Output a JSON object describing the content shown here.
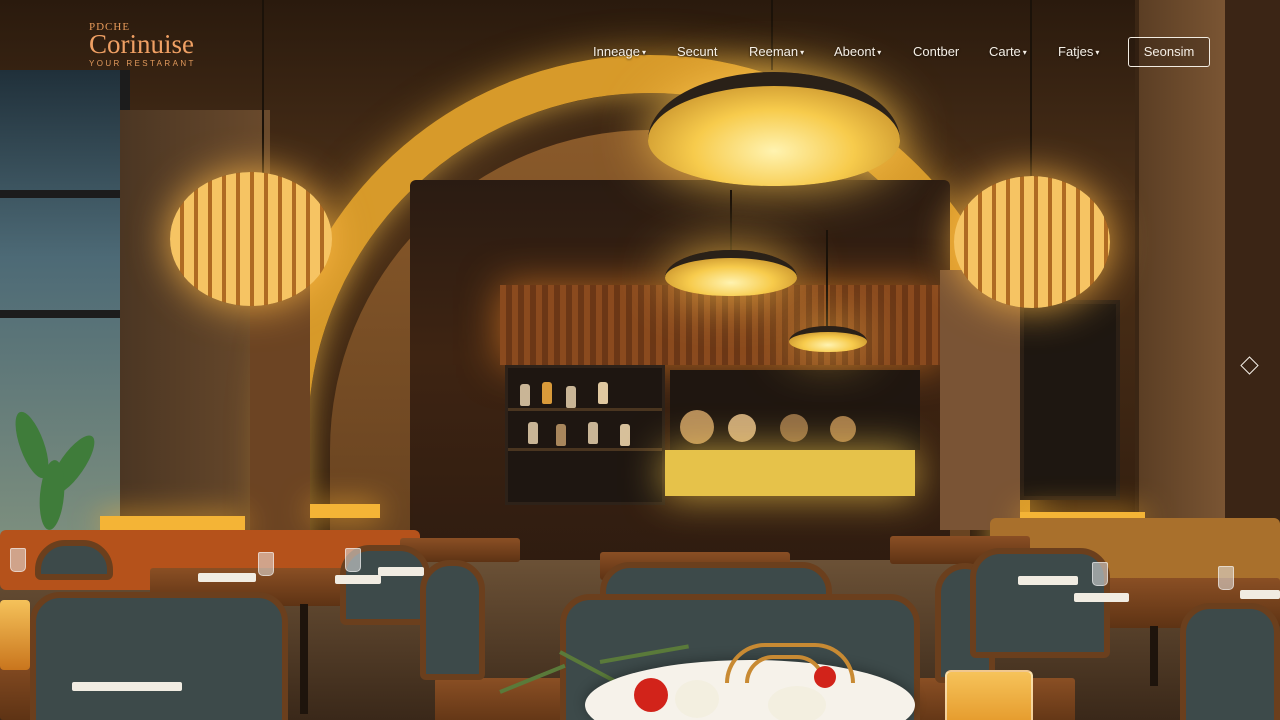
{
  "brand": {
    "small": "PDCHE",
    "name": "Corinuise",
    "tagline": "YOUR RESTARANT"
  },
  "nav": {
    "items": [
      {
        "label": "Inneage",
        "caret": "▾"
      },
      {
        "label": "Secunt",
        "caret": ""
      },
      {
        "label": "Reeman",
        "caret": "▾"
      },
      {
        "label": "Abeont",
        "caret": "▾"
      },
      {
        "label": "Contber",
        "caret": ""
      },
      {
        "label": "Carte",
        "caret": "▾"
      },
      {
        "label": "Fatjes",
        "caret": "▾"
      }
    ],
    "cta_label": "Seonsim"
  },
  "hero": {
    "scene": "restaurant-interior",
    "side_control_icon": "diamond-outline-icon"
  },
  "colors": {
    "brand_accent": "#f0a064",
    "nav_text": "#f5efe6",
    "lamp_glow": "#f7cb4c",
    "wood": "#8a4f24",
    "banquette": "#b5521b"
  }
}
